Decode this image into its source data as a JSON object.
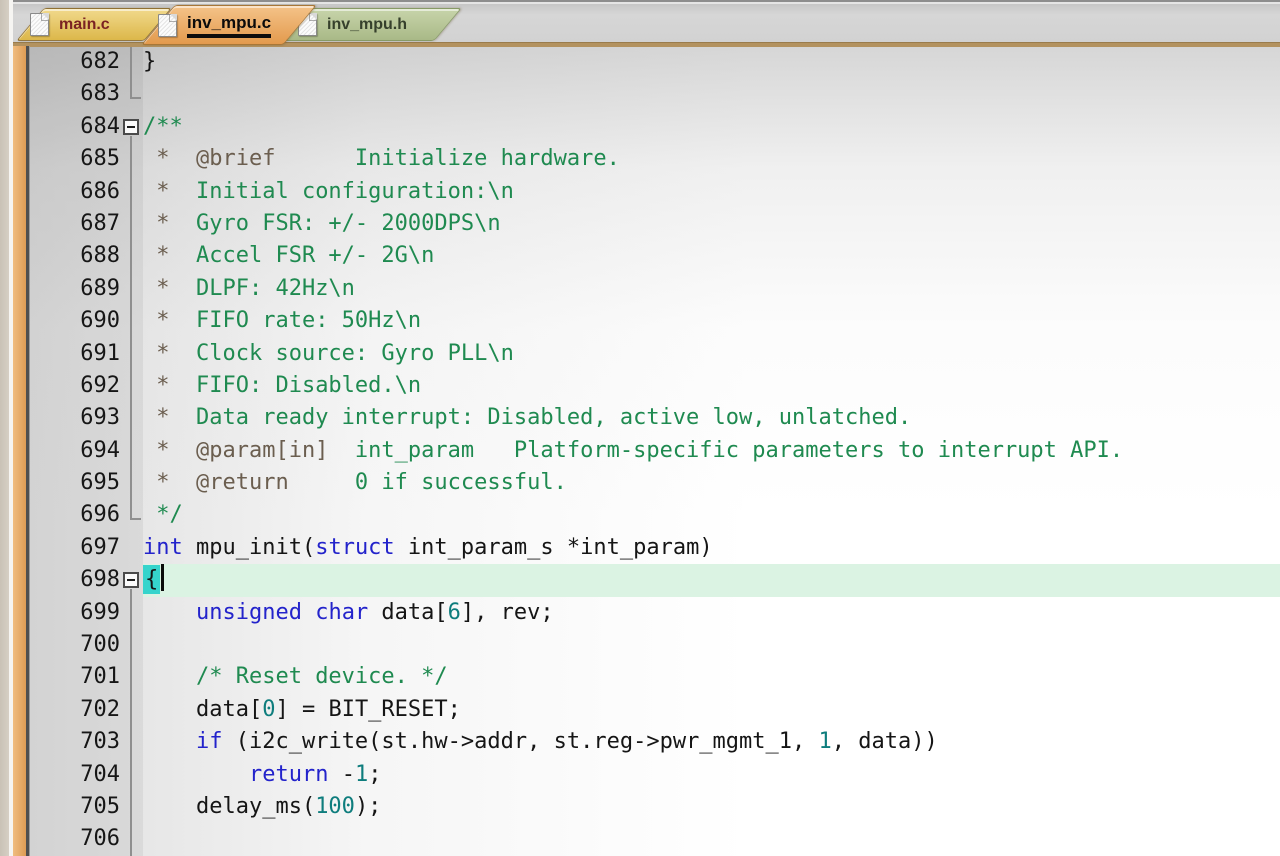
{
  "tabs": [
    {
      "label": "main.c",
      "active": false
    },
    {
      "label": "inv_mpu.c",
      "active": true
    },
    {
      "label": "inv_mpu.h",
      "active": false
    }
  ],
  "editor": {
    "first_line": 682,
    "last_line": 706,
    "caret_line": 698,
    "lines": [
      {
        "n": 682,
        "f": "bar",
        "s": [
          [
            "p",
            "}"
          ]
        ]
      },
      {
        "n": 683,
        "f": "end",
        "s": []
      },
      {
        "n": 684,
        "f": "box",
        "s": [
          [
            "c",
            "/**"
          ]
        ]
      },
      {
        "n": 685,
        "f": "bar",
        "s": [
          [
            "d",
            " *  @brief"
          ],
          [
            "c",
            "      Initialize hardware."
          ]
        ]
      },
      {
        "n": 686,
        "f": "bar",
        "s": [
          [
            "d",
            " *  "
          ],
          [
            "c",
            "Initial configuration:\\n"
          ]
        ]
      },
      {
        "n": 687,
        "f": "bar",
        "s": [
          [
            "d",
            " *  "
          ],
          [
            "c",
            "Gyro FSR: +/- 2000DPS\\n"
          ]
        ]
      },
      {
        "n": 688,
        "f": "bar",
        "s": [
          [
            "d",
            " *  "
          ],
          [
            "c",
            "Accel FSR +/- 2G\\n"
          ]
        ]
      },
      {
        "n": 689,
        "f": "bar",
        "s": [
          [
            "d",
            " *  "
          ],
          [
            "c",
            "DLPF: 42Hz\\n"
          ]
        ]
      },
      {
        "n": 690,
        "f": "bar",
        "s": [
          [
            "d",
            " *  "
          ],
          [
            "c",
            "FIFO rate: 50Hz\\n"
          ]
        ]
      },
      {
        "n": 691,
        "f": "bar",
        "s": [
          [
            "d",
            " *  "
          ],
          [
            "c",
            "Clock source: Gyro PLL\\n"
          ]
        ]
      },
      {
        "n": 692,
        "f": "bar",
        "s": [
          [
            "d",
            " *  "
          ],
          [
            "c",
            "FIFO: Disabled.\\n"
          ]
        ]
      },
      {
        "n": 693,
        "f": "bar",
        "s": [
          [
            "d",
            " *  "
          ],
          [
            "c",
            "Data ready interrupt: Disabled, active low, unlatched."
          ]
        ]
      },
      {
        "n": 694,
        "f": "bar",
        "s": [
          [
            "d",
            " *  @param[in]"
          ],
          [
            "c",
            "  int_param   Platform-specific parameters to interrupt API."
          ]
        ]
      },
      {
        "n": 695,
        "f": "bar",
        "s": [
          [
            "d",
            " *  @return"
          ],
          [
            "c",
            "     0 if successful."
          ]
        ]
      },
      {
        "n": 696,
        "f": "end",
        "s": [
          [
            "c",
            " */"
          ]
        ]
      },
      {
        "n": 697,
        "f": "none",
        "s": [
          [
            "k",
            "int"
          ],
          [
            "p",
            " mpu_init("
          ],
          [
            "k",
            "struct"
          ],
          [
            "p",
            " int_param_s *int_param)"
          ]
        ]
      },
      {
        "n": 698,
        "f": "box",
        "cur": true,
        "s": [
          [
            "b",
            "{"
          ],
          [
            "caret",
            ""
          ]
        ]
      },
      {
        "n": 699,
        "f": "bar",
        "s": [
          [
            "p",
            "    "
          ],
          [
            "k",
            "unsigned"
          ],
          [
            "p",
            " "
          ],
          [
            "k",
            "char"
          ],
          [
            "p",
            " data["
          ],
          [
            "n",
            "6"
          ],
          [
            "p",
            "], rev;"
          ]
        ]
      },
      {
        "n": 700,
        "f": "bar",
        "s": []
      },
      {
        "n": 701,
        "f": "bar",
        "s": [
          [
            "p",
            "    "
          ],
          [
            "c",
            "/* Reset device. */"
          ]
        ]
      },
      {
        "n": 702,
        "f": "bar",
        "s": [
          [
            "p",
            "    data["
          ],
          [
            "n",
            "0"
          ],
          [
            "p",
            "] = BIT_RESET;"
          ]
        ]
      },
      {
        "n": 703,
        "f": "bar",
        "s": [
          [
            "p",
            "    "
          ],
          [
            "k",
            "if"
          ],
          [
            "p",
            " (i2c_write(st.hw->addr, st.reg->pwr_mgmt_1, "
          ],
          [
            "n",
            "1"
          ],
          [
            "p",
            ", data))"
          ]
        ]
      },
      {
        "n": 704,
        "f": "bar",
        "s": [
          [
            "p",
            "        "
          ],
          [
            "k",
            "return"
          ],
          [
            "p",
            " -"
          ],
          [
            "n",
            "1"
          ],
          [
            "p",
            ";"
          ]
        ]
      },
      {
        "n": 705,
        "f": "bar",
        "s": [
          [
            "p",
            "    delay_ms("
          ],
          [
            "n",
            "100"
          ],
          [
            "p",
            ");"
          ]
        ]
      },
      {
        "n": 706,
        "f": "bar",
        "s": []
      }
    ]
  },
  "colors": {
    "keyword": "#2323cb",
    "number": "#0e7d7d",
    "comment": "#1f8a50",
    "doxytag": "#6b5e4f",
    "plain": "#151515",
    "brace_bg": "#35d4cc",
    "current_line_bg": "#dbf3e3",
    "accent": "#b3925f",
    "tab_gold_text": "#7b2323",
    "tab_active_text": "#0b0b0b",
    "tab_green_text": "#36402c",
    "gutter_text": "#161616",
    "fold_line": "#8f8f8f"
  }
}
